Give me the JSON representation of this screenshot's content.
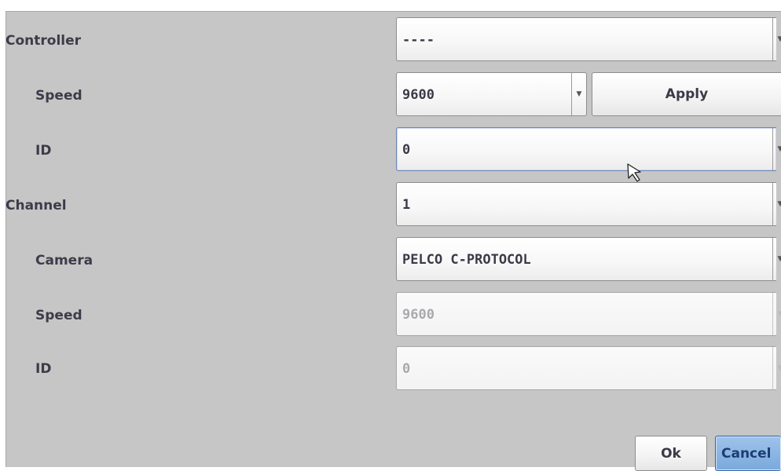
{
  "rows": {
    "controller": {
      "label": "Controller",
      "value": "----"
    },
    "controller_speed": {
      "label": "Speed",
      "value": "9600",
      "apply_label": "Apply"
    },
    "controller_id": {
      "label": "ID",
      "value": "0"
    },
    "channel": {
      "label": "Channel",
      "value": "1"
    },
    "camera": {
      "label": "Camera",
      "value": "PELCO C-PROTOCOL"
    },
    "camera_speed": {
      "label": "Speed",
      "value": "9600"
    },
    "camera_id": {
      "label": "ID",
      "value": "0"
    }
  },
  "buttons": {
    "ok": "Ok",
    "cancel": "Cancel"
  },
  "icons": {
    "dropdown": "chevron-down-icon",
    "cursor": "mouse-pointer-icon"
  },
  "colors": {
    "panel_bg": "#c6c6c6",
    "cancel_focus": "#7aa9dc",
    "label_text": "#3c3c4a"
  }
}
